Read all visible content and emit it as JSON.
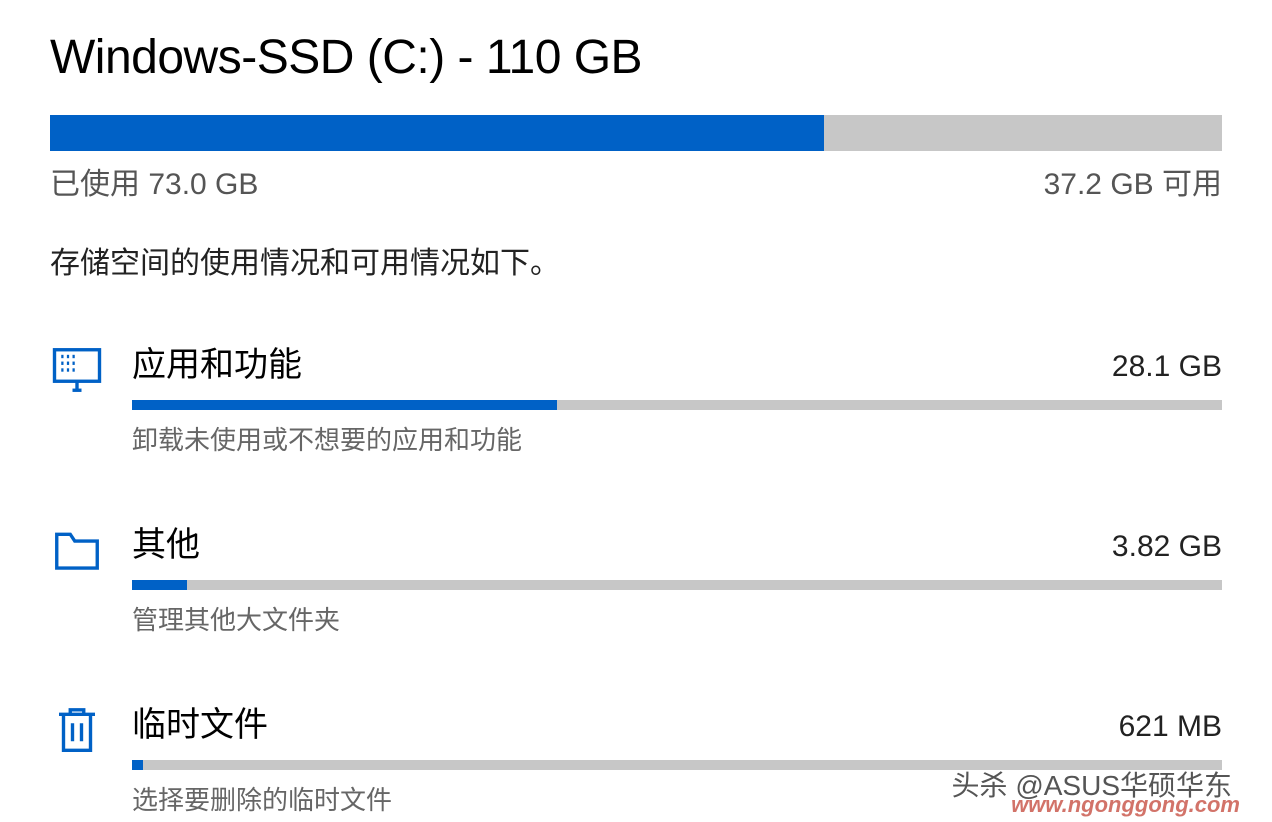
{
  "title": "Windows-SSD (C:) - 110 GB",
  "main_bar_percent": 66,
  "used_label": "已使用 73.0 GB",
  "free_label": "37.2 GB 可用",
  "description": "存储空间的使用情况和可用情况如下。",
  "categories": [
    {
      "label": "应用和功能",
      "size": "28.1 GB",
      "percent": 39,
      "hint": "卸载未使用或不想要的应用和功能"
    },
    {
      "label": "其他",
      "size": "3.82 GB",
      "percent": 5,
      "hint": "管理其他大文件夹"
    },
    {
      "label": "临时文件",
      "size": "621 MB",
      "percent": 1,
      "hint": "选择要删除的临时文件"
    }
  ],
  "watermark1": "头杀 @ASUS华硕华东",
  "watermark2": "www.ngonggong.com"
}
